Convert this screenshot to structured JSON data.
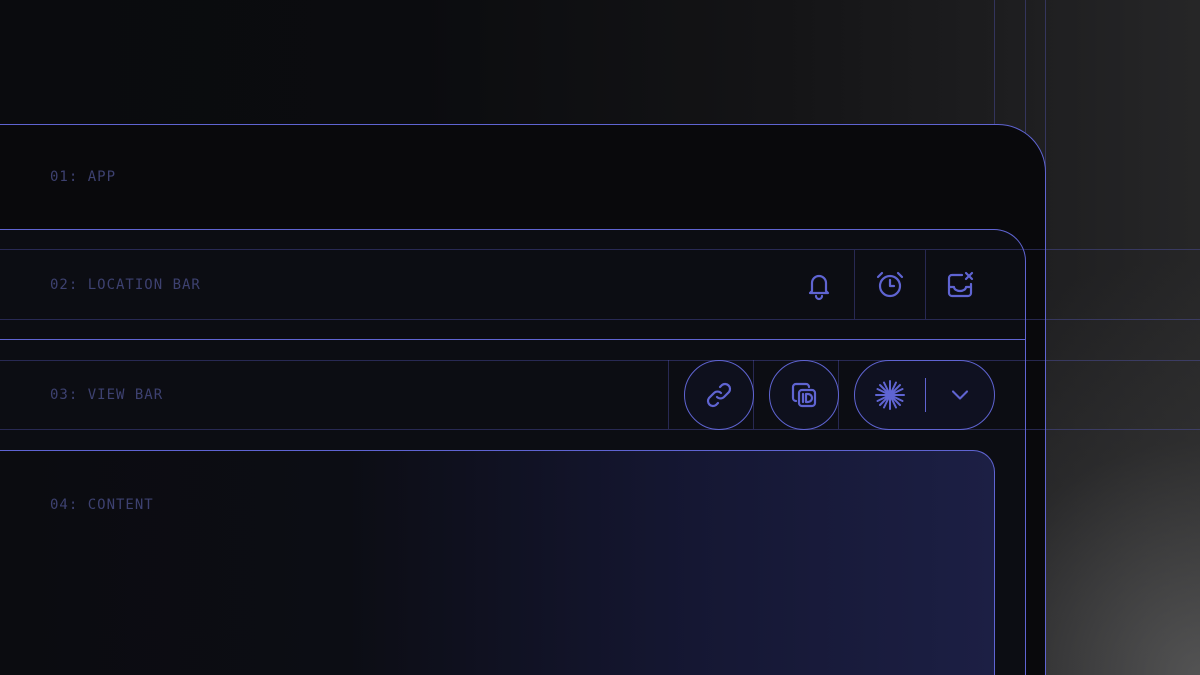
{
  "layers": {
    "app": "01: APP",
    "location_bar": "02: LOCATION BAR",
    "view_bar": "03: VIEW BAR",
    "content": "04: CONTENT"
  },
  "location_bar_actions": [
    {
      "icon": "bell-icon",
      "name": "notifications-button"
    },
    {
      "icon": "alarm-clock-icon",
      "name": "reminders-button"
    },
    {
      "icon": "inbox-remove-icon",
      "name": "clear-inbox-button"
    }
  ],
  "view_bar_actions": [
    {
      "icon": "link-icon",
      "name": "copy-link-button"
    },
    {
      "icon": "copy-id-icon",
      "name": "copy-id-button"
    },
    {
      "icon": "sparkle-burst-icon",
      "name": "ai-action-button"
    },
    {
      "icon": "chevron-down-icon",
      "name": "more-options-button"
    }
  ],
  "colors": {
    "accent": "#5f64d2",
    "label": "#3d4170",
    "background": "#0a0b0e"
  }
}
